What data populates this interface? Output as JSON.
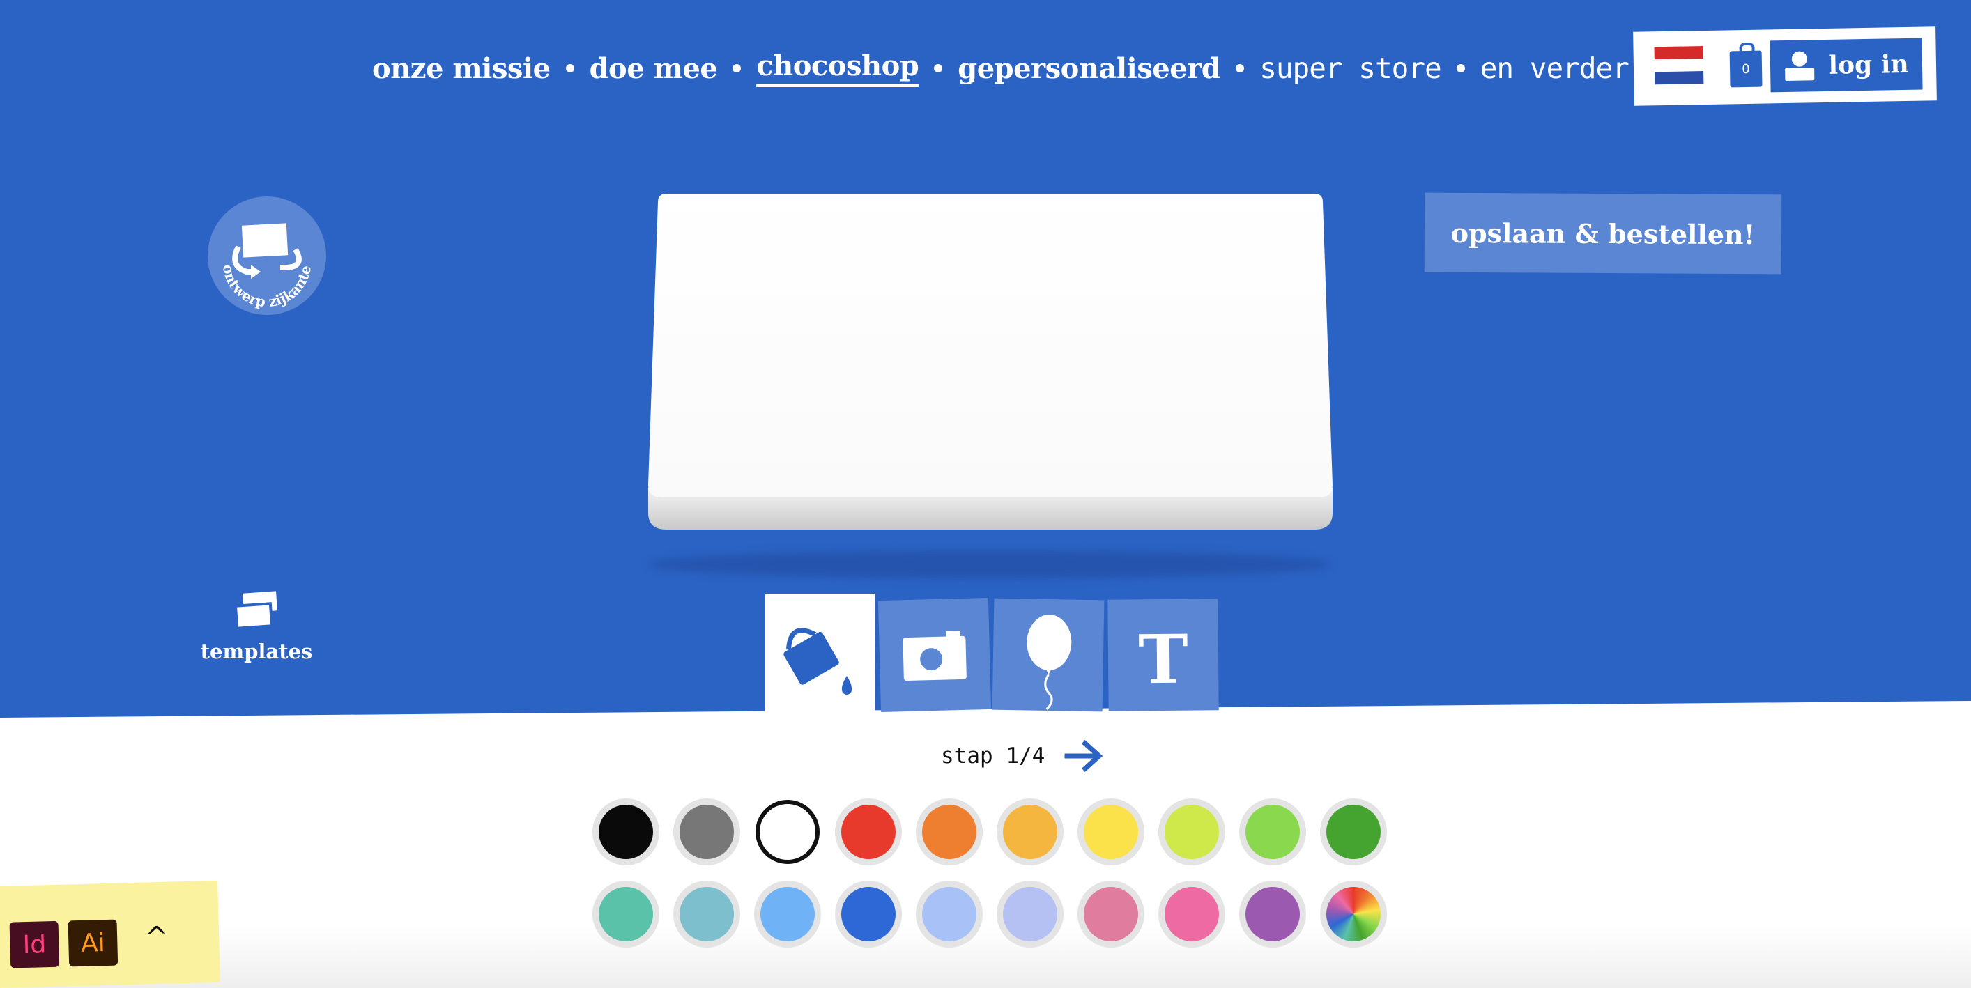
{
  "nav": {
    "items": [
      {
        "label": "onze missie",
        "style": "bold"
      },
      {
        "label": "doe mee",
        "style": "bold"
      },
      {
        "label": "chocoshop",
        "style": "bold",
        "active": true
      },
      {
        "label": "gepersonaliseerd",
        "style": "bold"
      },
      {
        "label": "super store",
        "style": "light"
      },
      {
        "label": "en verder..",
        "style": "light"
      }
    ]
  },
  "header": {
    "flag_colors": [
      "#d42a2a",
      "#ffffff",
      "#2b4ea8"
    ],
    "cart_count": "0",
    "login_label": "log in"
  },
  "sides_badge": {
    "label": "ontwerp zijkanten",
    "icon": "rotate-sides-icon"
  },
  "save_button": {
    "label": "opslaan & bestellen!"
  },
  "templates": {
    "label": "templates",
    "icon": "templates-icon"
  },
  "tools": [
    {
      "name": "paint-bucket-icon",
      "active": true
    },
    {
      "name": "camera-icon",
      "active": false
    },
    {
      "name": "balloon-icon",
      "active": false
    },
    {
      "name": "text-tool-icon",
      "glyph": "T",
      "active": false
    }
  ],
  "step": {
    "label": "stap 1/4",
    "next_icon": "arrow-right-icon"
  },
  "swatches": {
    "row1": [
      "#0a0a0a",
      "#777777",
      "#ffffff",
      "#e83a2c",
      "#ef7f30",
      "#f4b63f",
      "#fce24a",
      "#cfe84a",
      "#8ad84e",
      "#45a32f"
    ],
    "row2": [
      "#5bc2aa",
      "#7dbfcc",
      "#6fb2f5",
      "#2e68d6",
      "#a8c2f7",
      "#b5c0f3",
      "#e07d9e",
      "#ee6aa3",
      "#9c59b0",
      "multicolor"
    ],
    "selected": "#ffffff"
  },
  "adobe": {
    "apps": [
      "Id",
      "Ai"
    ],
    "toggle": "^"
  }
}
